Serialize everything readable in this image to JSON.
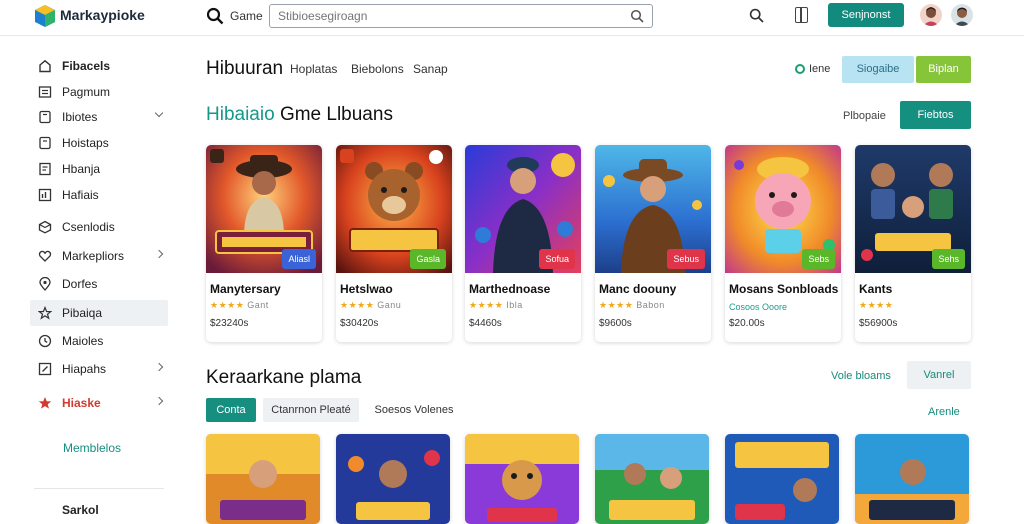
{
  "app": {
    "logo_text": "Markaypioke",
    "games_label": "Game",
    "search_placeholder": "Stibioesegiroagn",
    "cta": "Senjnonst"
  },
  "sidebar": {
    "items": [
      {
        "label": "Fibacels",
        "icon": "home-icon"
      },
      {
        "label": "Pagmum",
        "icon": "list-icon"
      },
      {
        "label": "Ibiotes",
        "icon": "tag-icon"
      },
      {
        "label": "Hoistaps",
        "icon": "tag-icon"
      },
      {
        "label": "Hbanja",
        "icon": "document-icon"
      },
      {
        "label": "Hafiais",
        "icon": "chart-icon"
      },
      {
        "label": "Csenlodis",
        "icon": "cube-icon"
      },
      {
        "label": "Markepliors",
        "icon": "heart-icon"
      },
      {
        "label": "Dorfes",
        "icon": "location-icon"
      },
      {
        "label": "Pibaiqa",
        "icon": "flag-icon"
      },
      {
        "label": "Maioles",
        "icon": "clock-icon"
      },
      {
        "label": "Hiapahs",
        "icon": "edit-icon"
      },
      {
        "label": "Hiaske",
        "icon": "star-icon"
      }
    ],
    "sub_label": "Memblelos",
    "footer_label": "Sarkol"
  },
  "main": {
    "title": "Hibuuran",
    "tabs": [
      "Hoplatas",
      "Biebolons",
      "Sanap"
    ],
    "status": "Iene",
    "btn_light": "Siogaibe",
    "btn_green": "Biplan",
    "section1": {
      "title_hl": "Hibaiaio",
      "title_rest": "Gme Llbuans",
      "link": "Plbopaie",
      "button": "Fiebtos",
      "cards": [
        {
          "name": "Manytersary",
          "rating": "★★★★",
          "count": "Gant",
          "price": "$23240s",
          "tag": "Aliasl",
          "tag_color": "#3a63d8"
        },
        {
          "name": "Hetslwao",
          "rating": "★★★★",
          "count": "Ganu",
          "price": "$30420s",
          "tag": "Gasla",
          "tag_color": "#5bb72a"
        },
        {
          "name": "Marthednoase",
          "rating": "★★★★",
          "count": "Ibla",
          "price": "$4460s",
          "tag": "Sofua",
          "tag_color": "#e0344a"
        },
        {
          "name": "Manc doouny",
          "rating": "★★★★",
          "count": "Babon",
          "price": "$9600s",
          "tag": "Sebus",
          "tag_color": "#e0344a"
        },
        {
          "name": "Mosans Sonbloads",
          "sub": "Cosoos Ooore",
          "price": "$20.00s",
          "tag": "Sebs",
          "tag_color": "#5bb72a"
        },
        {
          "name": "Kants",
          "rating": "★★★★",
          "count": "",
          "price": "$56900s",
          "tag": "Sehs",
          "tag_color": "#5bb72a"
        }
      ]
    },
    "section2": {
      "title": "Keraarkane plama",
      "link": "Vole bloams",
      "button": "Vanrel",
      "chips": [
        "Conta",
        "Ctanrnon Pleaté",
        "Soesos Volenes"
      ],
      "right_link": "Arenle"
    }
  }
}
